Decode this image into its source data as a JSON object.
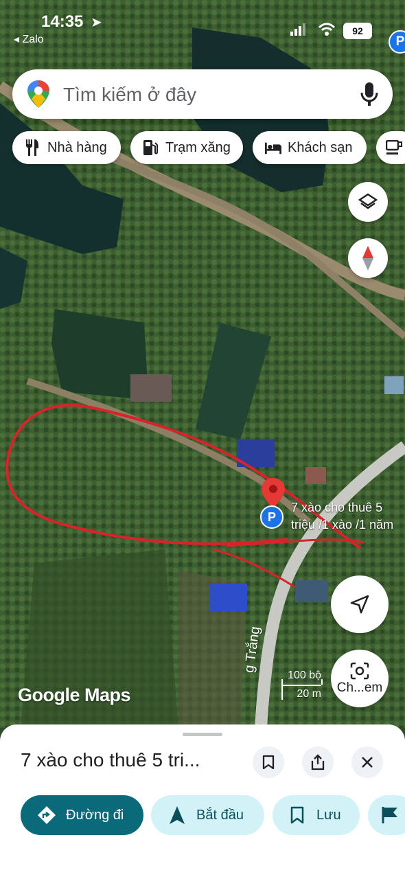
{
  "status_bar": {
    "time": "14:35",
    "back_app": "◂ Zalo",
    "battery": "92"
  },
  "search": {
    "placeholder": "Tìm kiếm ở đây"
  },
  "chips": [
    {
      "label": "Nhà hàng",
      "icon": "fork-knife-icon"
    },
    {
      "label": "Trạm xăng",
      "icon": "gas-station-icon"
    },
    {
      "label": "Khách sạn",
      "icon": "bed-icon"
    },
    {
      "label": "",
      "icon": "coffee-icon"
    }
  ],
  "map": {
    "place_label_line1": "7 xào cho thuê 5",
    "place_label_line2": "triệu /1 xào /1 năm",
    "road_label": "g Trắng",
    "attribution": "Google Maps",
    "scale_imperial": "100 bộ",
    "scale_metric": "20 m",
    "lens_label": "Ch...em"
  },
  "sheet": {
    "title": "7 xào cho thuê 5 tri...",
    "actions": [
      {
        "label": "Đường đi",
        "icon": "directions-icon"
      },
      {
        "label": "Bắt đầu",
        "icon": "navigation-arrow-icon"
      },
      {
        "label": "Lưu",
        "icon": "bookmark-icon"
      },
      {
        "label": "",
        "icon": "flag-icon"
      }
    ]
  },
  "colors": {
    "primary": "#0b6a7a",
    "tonal": "#d3f2f7",
    "pin_red": "#e53935",
    "annotation_red": "#d8232a",
    "map_blue": "#1a73e8"
  }
}
